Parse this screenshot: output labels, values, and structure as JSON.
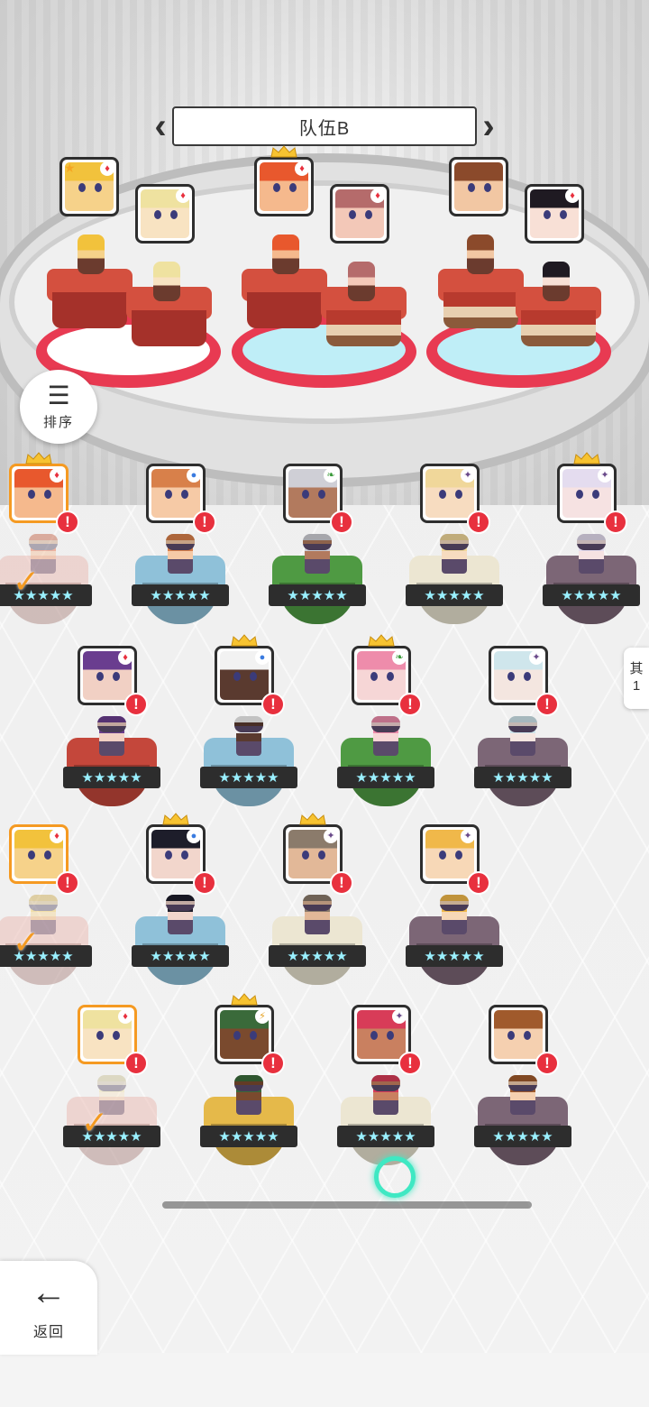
{
  "team": {
    "title": "队伍B",
    "prev_icon": "chevron-left-icon",
    "next_icon": "chevron-right-icon"
  },
  "sort_button": {
    "label": "排序",
    "icon": "sort-icon"
  },
  "side_tab": {
    "line1": "其",
    "line2": "1"
  },
  "back_button": {
    "label": "返回",
    "icon": "arrow-left-icon"
  },
  "alert_mark": "!",
  "check_mark": "✓",
  "stars_text": "★★★★★",
  "colors": {
    "alert": "#e8303e",
    "selected_border": "#f59a22",
    "platform_red": "#e83a52",
    "platform_ice": "#bfeef7",
    "crown": "#f7c331"
  },
  "team_slots": [
    {
      "element": "♦",
      "star": true,
      "face": "#f6d28a",
      "hair": "#f2c23c"
    },
    {
      "element": "♦",
      "star": false,
      "face": "#f8e3c2",
      "hair": "#efe2a0"
    },
    {
      "element": "♦",
      "star": false,
      "crown": true,
      "face": "#f5b98d",
      "hair": "#e8582d"
    },
    {
      "element": "♦",
      "star": false,
      "face": "#f3c8b8",
      "hair": "#b56b6b"
    },
    {
      "element": "",
      "star": false,
      "face": "#f2c7a3",
      "hair": "#8b4a2b"
    },
    {
      "element": "♦",
      "star": false,
      "face": "#f8e0d6",
      "hair": "#1f1a22"
    }
  ],
  "roster": [
    {
      "row": 0,
      "element": "♦",
      "crown": true,
      "selected": true,
      "face": "#f5b98d",
      "hair": "#e8582d",
      "stand": "#e9b7b0",
      "ghost": true
    },
    {
      "row": 0,
      "element": "●",
      "crown": false,
      "selected": false,
      "face": "#f6caa6",
      "hair": "#d8804a",
      "stand": "#8fc1d9"
    },
    {
      "row": 0,
      "element": "❧",
      "crown": false,
      "selected": false,
      "face": "#b27a5e",
      "hair": "#cfcfd6",
      "stand": "#4f9a43"
    },
    {
      "row": 0,
      "element": "✦",
      "crown": false,
      "selected": false,
      "face": "#f7dcc0",
      "hair": "#f0d79a",
      "stand": "#ece6d2"
    },
    {
      "row": 0,
      "element": "✦",
      "crown": true,
      "selected": false,
      "face": "#f6e2e2",
      "hair": "#e4dcef",
      "stand": "#7c6676"
    },
    {
      "row": 1,
      "element": "♦",
      "crown": false,
      "selected": false,
      "face": "#f1d0c4",
      "hair": "#6a3d8f",
      "stand": "#c4473b"
    },
    {
      "row": 1,
      "element": "●",
      "crown": true,
      "selected": false,
      "face": "#5a3a2f",
      "hair": "#f2f2f2",
      "stand": "#8fc1d9"
    },
    {
      "row": 1,
      "element": "❧",
      "crown": true,
      "selected": false,
      "face": "#f6d6d6",
      "hair": "#ee8cab",
      "stand": "#4f9a43"
    },
    {
      "row": 1,
      "element": "✦",
      "crown": false,
      "selected": false,
      "face": "#f4e6e0",
      "hair": "#cfe6ec",
      "stand": "#7c6676"
    },
    {
      "row": 2,
      "element": "♦",
      "crown": false,
      "selected": true,
      "face": "#f6d28a",
      "hair": "#f2c23c",
      "stand": "#e9b7b0",
      "ghost": true
    },
    {
      "row": 2,
      "element": "●",
      "crown": true,
      "selected": false,
      "face": "#f2d6cc",
      "hair": "#1d1d2a",
      "stand": "#8fc1d9"
    },
    {
      "row": 2,
      "element": "✦",
      "crown": true,
      "selected": false,
      "face": "#e2b898",
      "hair": "#8b7b6b",
      "stand": "#ece6d2"
    },
    {
      "row": 2,
      "element": "✦",
      "crown": false,
      "selected": false,
      "face": "#f7d8b7",
      "hair": "#f0b84a",
      "stand": "#7c6676"
    },
    {
      "row": 3,
      "element": "♦",
      "crown": false,
      "selected": true,
      "face": "#f8e3c2",
      "hair": "#efe2a0",
      "stand": "#e9b7b0",
      "ghost": true
    },
    {
      "row": 3,
      "element": "⚡",
      "crown": true,
      "selected": false,
      "face": "#7a4a2e",
      "hair": "#3a6a3a",
      "stand": "#e5b94a"
    },
    {
      "row": 3,
      "element": "✦",
      "crown": false,
      "selected": false,
      "face": "#c98060",
      "hair": "#d83c58",
      "stand": "#ece6d2"
    },
    {
      "row": 3,
      "element": "",
      "crown": false,
      "selected": false,
      "face": "#f5d0b0",
      "hair": "#a05a2c",
      "stand": "#7c6676"
    }
  ]
}
